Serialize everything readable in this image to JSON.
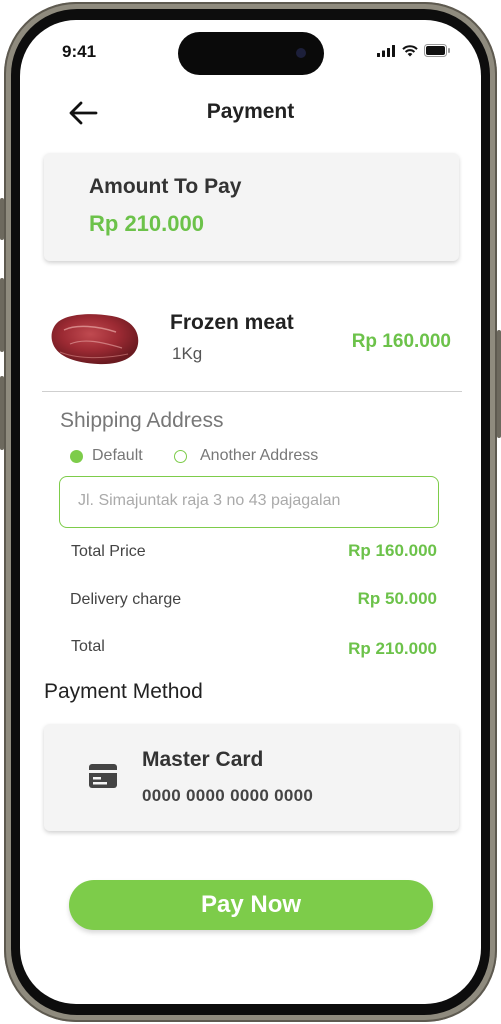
{
  "status_bar": {
    "time": "9:41"
  },
  "header": {
    "title": "Payment"
  },
  "amount_card": {
    "label": "Amount To Pay",
    "value": "Rp 210.000"
  },
  "product": {
    "name": "Frozen meat",
    "quantity": "1Kg",
    "price": "Rp 160.000"
  },
  "shipping": {
    "title": "Shipping Address",
    "options": [
      "Default",
      "Another Address"
    ],
    "selected": "Default",
    "address_value": "Jl. Simajuntak raja 3 no 43 pajagalan"
  },
  "summary": {
    "rows": [
      {
        "label": "Total Price",
        "value": "Rp 160.000"
      },
      {
        "label": "Delivery charge",
        "value": "Rp 50.000"
      },
      {
        "label": "Total",
        "value": "Rp 210.000"
      }
    ]
  },
  "payment_method": {
    "title": "Payment Method",
    "card_name": "Master Card",
    "card_number": "0000 0000 0000 0000",
    "icon": "credit-card-icon"
  },
  "pay_button": {
    "label": "Pay Now"
  },
  "colors": {
    "accent": "#6cc24a",
    "button": "#7dcc4a",
    "card_bg": "#f4f4f4",
    "text": "#222222"
  }
}
